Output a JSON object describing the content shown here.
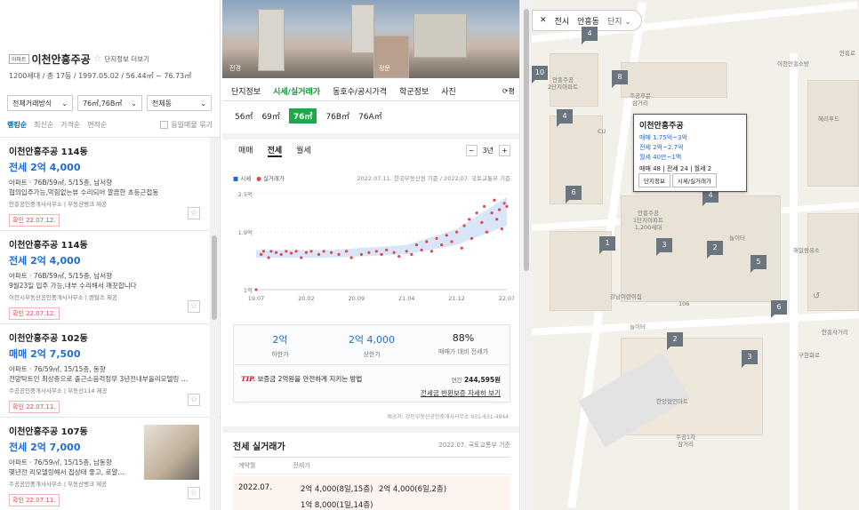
{
  "complex": {
    "tag": "아파트",
    "name": "이천안흥주공",
    "info_link": "단지정보 더보기",
    "sub": "1200세대 / 총 17동 / 1997.05.02 / 56.44㎡ ~ 76.73㎡"
  },
  "filters": [
    "전체거래방식",
    "76㎡,76B㎡",
    "전체동"
  ],
  "sorts": [
    "랭킹순",
    "최신순",
    "가격순",
    "면적순"
  ],
  "same_toggle": "동일매물 묶기",
  "listings": [
    {
      "title": "이천안흥주공 114동",
      "price": "전세 2억 4,000",
      "detail": "아파트 · 76B/59㎡, 5/15층, 남서향",
      "desc": "협의입주가능,막힘없는뷰 수리되어 깔끔한 초등근접동",
      "source": "안흥공인중개사사무소 | 부동산뱅크 제공",
      "confirm": "확인 22.07.12."
    },
    {
      "title": "이천안흥주공 114동",
      "price": "전세 2억 4,000",
      "detail": "아파트 · 76B/59㎡, 5/15층, 남서향",
      "desc": "9월23일 입주 가능,내부 수리해서 깨끗합니다",
      "source": "이천시부동산공인중개사사무소 | 렌탈즈 제공",
      "confirm": "확인 22.07.12."
    },
    {
      "title": "이천안흥주공 102동",
      "price": "매매 2억 7,500",
      "detail": "아파트 · 76/59㎡, 15/15층, 동향",
      "desc": "전망탁트인 최상층으로 출근소음걱정무 3년전내부올리모델링 …",
      "source": "주공공인중개사사무소 | 부동산114 제공",
      "confirm": "확인 22.07.11."
    },
    {
      "title": "이천안흥주공 107동",
      "price": "전세 2억 7,000",
      "detail": "아파트 · 76/59㎡, 15/15층, 남동향",
      "desc": "몇년전 리모델링해서 집상태 좋고, 로얄…",
      "source": "주공공인중개사사무소 | 부동산뱅크 제공",
      "confirm": "확인 22.07.11."
    }
  ],
  "photo_labels": [
    "전경",
    "정문"
  ],
  "tabs": [
    "단지정보",
    "시세/실거래가",
    "동호수/공시가격",
    "학군정보",
    "사진"
  ],
  "tab_extra": "평",
  "areas": [
    "56㎡",
    "69㎡",
    "76㎡",
    "76B㎡",
    "76A㎡"
  ],
  "trade_tabs": [
    "매매",
    "전세",
    "월세"
  ],
  "period": "3년",
  "legend": [
    "시세",
    "실거래가"
  ],
  "source_note": "2022.07.11. 한국부동산원 기준 / 2022.07. 국토교통부 기준",
  "chart_data": {
    "type": "scatter",
    "x_ticks": [
      "19.07",
      "20.02",
      "20.09",
      "21.04",
      "21.12",
      "22.07"
    ],
    "y_ticks": [
      "2.5억",
      "1.9억",
      "1억"
    ],
    "ylim": [
      1.0,
      2.5
    ],
    "series": [
      {
        "name": "실거래가",
        "color": "#e0474c",
        "points": [
          [
            0.0,
            1.0
          ],
          [
            0.02,
            1.55
          ],
          [
            0.03,
            1.6
          ],
          [
            0.05,
            1.5
          ],
          [
            0.06,
            1.6
          ],
          [
            0.08,
            1.58
          ],
          [
            0.1,
            1.55
          ],
          [
            0.12,
            1.6
          ],
          [
            0.14,
            1.57
          ],
          [
            0.16,
            1.6
          ],
          [
            0.18,
            1.5
          ],
          [
            0.2,
            1.58
          ],
          [
            0.22,
            1.6
          ],
          [
            0.25,
            1.55
          ],
          [
            0.27,
            1.6
          ],
          [
            0.3,
            1.58
          ],
          [
            0.33,
            1.55
          ],
          [
            0.36,
            1.6
          ],
          [
            0.38,
            1.5
          ],
          [
            0.42,
            1.55
          ],
          [
            0.45,
            1.58
          ],
          [
            0.48,
            1.6
          ],
          [
            0.5,
            1.55
          ],
          [
            0.52,
            1.62
          ],
          [
            0.55,
            1.58
          ],
          [
            0.57,
            1.52
          ],
          [
            0.6,
            1.6
          ],
          [
            0.62,
            1.55
          ],
          [
            0.64,
            1.7
          ],
          [
            0.66,
            1.62
          ],
          [
            0.68,
            1.75
          ],
          [
            0.7,
            1.6
          ],
          [
            0.72,
            1.8
          ],
          [
            0.74,
            1.7
          ],
          [
            0.76,
            1.85
          ],
          [
            0.78,
            1.75
          ],
          [
            0.8,
            1.9
          ],
          [
            0.82,
            1.65
          ],
          [
            0.83,
            2.0
          ],
          [
            0.85,
            2.1
          ],
          [
            0.86,
            1.8
          ],
          [
            0.88,
            2.2
          ],
          [
            0.9,
            2.05
          ],
          [
            0.91,
            2.3
          ],
          [
            0.92,
            1.9
          ],
          [
            0.94,
            2.2
          ],
          [
            0.95,
            2.4
          ],
          [
            0.96,
            2.1
          ],
          [
            0.97,
            2.25
          ],
          [
            0.98,
            1.95
          ],
          [
            0.99,
            2.35
          ],
          [
            1.0,
            2.3
          ]
        ]
      }
    ],
    "band": [
      [
        0.0,
        1.5,
        1.62
      ],
      [
        0.3,
        1.5,
        1.62
      ],
      [
        0.6,
        1.55,
        1.7
      ],
      [
        0.8,
        1.7,
        1.95
      ],
      [
        1.0,
        2.0,
        2.45
      ]
    ]
  },
  "summary": {
    "low_value": "2억",
    "low_label": "하한가",
    "high_value": "2억 4,000",
    "high_label": "상한가",
    "ratio_value": "88%",
    "ratio_label": "매매가 대비 전세가"
  },
  "tip": {
    "mark": "TIP.",
    "text": "보증금 2억원을 안전하게 지키는 방법",
    "amount_label": "연간",
    "amount": "244,595원",
    "link": "전세금 반환보증 자세히 보기"
  },
  "provider": "제공처: 강인부동산공인중개사사무소 031-631-4944",
  "recent": {
    "title": "전세 실거래가",
    "source": "2022.07. 국토교통부 기준",
    "col1": "계약월",
    "col2": "전세가",
    "month": "2022.07.",
    "line1a": "2억 4,000(8일,15층)",
    "line1b": "2억 4,000(6일,2층)",
    "line2": "1억 8,000(1일,14층)"
  },
  "map": {
    "topbar": [
      "전시",
      "안흥동",
      "단지"
    ],
    "markers": [
      "10",
      "4",
      "8",
      "4",
      "6",
      "1",
      "3",
      "2",
      "5",
      "6",
      "2",
      "3",
      "4",
      "2"
    ],
    "labels": [
      "안흥주공\n2단지아파트",
      "주공후문\n삼거리",
      "이천안흥소방",
      "헤리푸드",
      "안흥주공\n1단지아파트\n1,200세대",
      "놀이터",
      "해일랑유소",
      "강남이란이집",
      "106",
      "놀이터",
      "한양협인마트",
      "주공1차\n삼거리",
      "안흥사거리",
      "구한화로",
      "안흥로",
      "CU"
    ],
    "popup": {
      "name": "이천안흥주공",
      "sale": "매매 1.75억~3억",
      "jeonse": "전세 2억~2.7억",
      "rent": "월세 40만~1백",
      "count_sale": "매매 48",
      "count_jeonse": "전세 24",
      "count_rent": "월세 2",
      "btn1": "단지정보",
      "btn2": "시세/실거래가"
    }
  }
}
